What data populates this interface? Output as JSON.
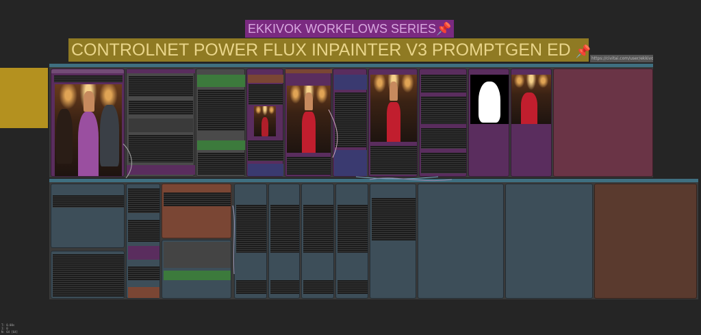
{
  "canvas": {
    "title_series": "EKKIVOK WORKFLOWS SERIES",
    "title_main": "CONTROLNET POWER FLUX INPAINTER V3 PROMPTGEN ED",
    "pin_glyph": "📌",
    "note_text": "https://civitai.com/user/ekkivok",
    "stats_line1": "T: 0.00s",
    "stats_line2": "I: 0",
    "stats_line3": "N: 64 [64]"
  },
  "colors": {
    "background": "#252525",
    "purple_group": "#5a2d5e",
    "teal_group": "#3d4e59",
    "gold_group": "#b4911f",
    "brown_node": "#7a4634",
    "green_node": "#3c7a3c"
  },
  "icons": [
    "pin-icon",
    "mask-image",
    "photo-preview"
  ]
}
